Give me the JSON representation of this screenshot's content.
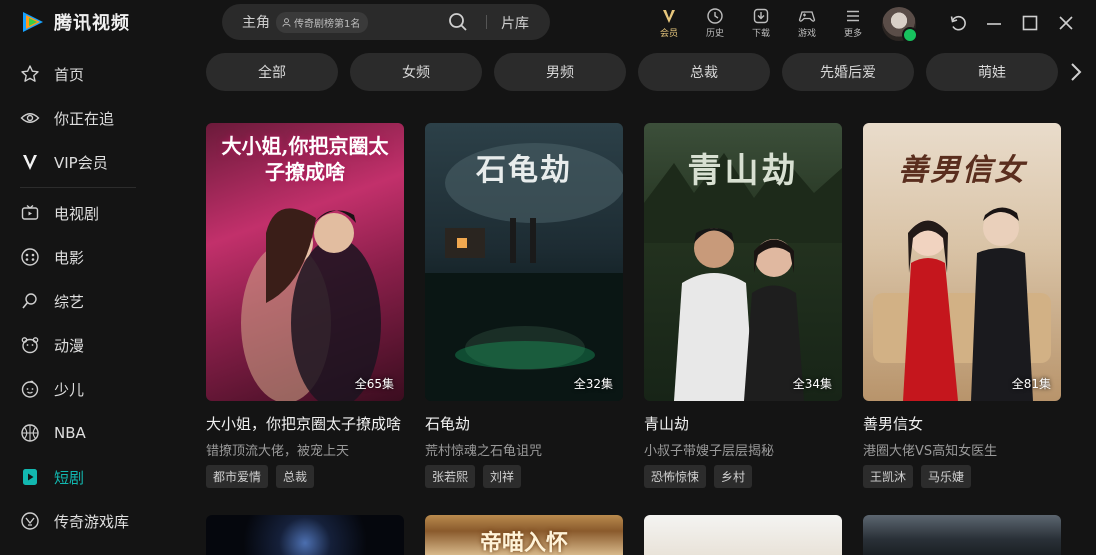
{
  "app": {
    "name": "腾讯视频"
  },
  "search": {
    "query": "主角",
    "tag": "传奇剧榜第1名",
    "library": "片库"
  },
  "toolbar": [
    {
      "label": "会员",
      "icon": "vip-icon"
    },
    {
      "label": "历史",
      "icon": "history-icon"
    },
    {
      "label": "下载",
      "icon": "download-icon"
    },
    {
      "label": "游戏",
      "icon": "gamepad-icon"
    },
    {
      "label": "更多",
      "icon": "menu-icon"
    }
  ],
  "sidebar": {
    "items": [
      {
        "label": "首页",
        "icon": "star-icon"
      },
      {
        "label": "你正在追",
        "icon": "eye-icon"
      },
      {
        "label": "VIP会员",
        "icon": "vip-v-icon"
      },
      {
        "label": "电视剧",
        "icon": "tv-icon"
      },
      {
        "label": "电影",
        "icon": "film-icon"
      },
      {
        "label": "综艺",
        "icon": "variety-icon"
      },
      {
        "label": "动漫",
        "icon": "anime-icon"
      },
      {
        "label": "少儿",
        "icon": "kids-icon"
      },
      {
        "label": "NBA",
        "icon": "basketball-icon"
      },
      {
        "label": "短剧",
        "icon": "short-drama-icon",
        "active": true
      },
      {
        "label": "传奇游戏库",
        "icon": "legend-game-icon"
      }
    ]
  },
  "chips": [
    "全部",
    "女频",
    "男频",
    "总裁",
    "先婚后爱",
    "萌娃"
  ],
  "cards": [
    {
      "poster_title": "大小姐,你把京圈太子撩成啥",
      "episodes": "全65集",
      "title": "大小姐，你把京圈太子撩成啥",
      "subtitle": "错撩顶流大佬，被宠上天",
      "tags": [
        "都市爱情",
        "总裁"
      ]
    },
    {
      "poster_title": "石龟劫",
      "episodes": "全32集",
      "title": "石龟劫",
      "subtitle": "荒村惊魂之石龟诅咒",
      "tags": [
        "张若熙",
        "刘祥"
      ]
    },
    {
      "poster_title": "青山劫",
      "episodes": "全34集",
      "title": "青山劫",
      "subtitle": "小叔子带嫂子层层揭秘",
      "tags": [
        "恐怖惊悚",
        "乡村"
      ]
    },
    {
      "poster_title": "善男信女",
      "episodes": "全81集",
      "title": "善男信女",
      "subtitle": "港圈大佬VS高知女医生",
      "tags": [
        "王凯沐",
        "马乐婕"
      ]
    }
  ],
  "cards_row2": [
    {
      "poster_title": ""
    },
    {
      "poster_title": "帝喵入怀"
    },
    {
      "poster_title": ""
    },
    {
      "poster_title": ""
    }
  ],
  "colors": {
    "accent": "#12b8b0",
    "vip_gold": "#e7c77d",
    "background": "#141414"
  }
}
